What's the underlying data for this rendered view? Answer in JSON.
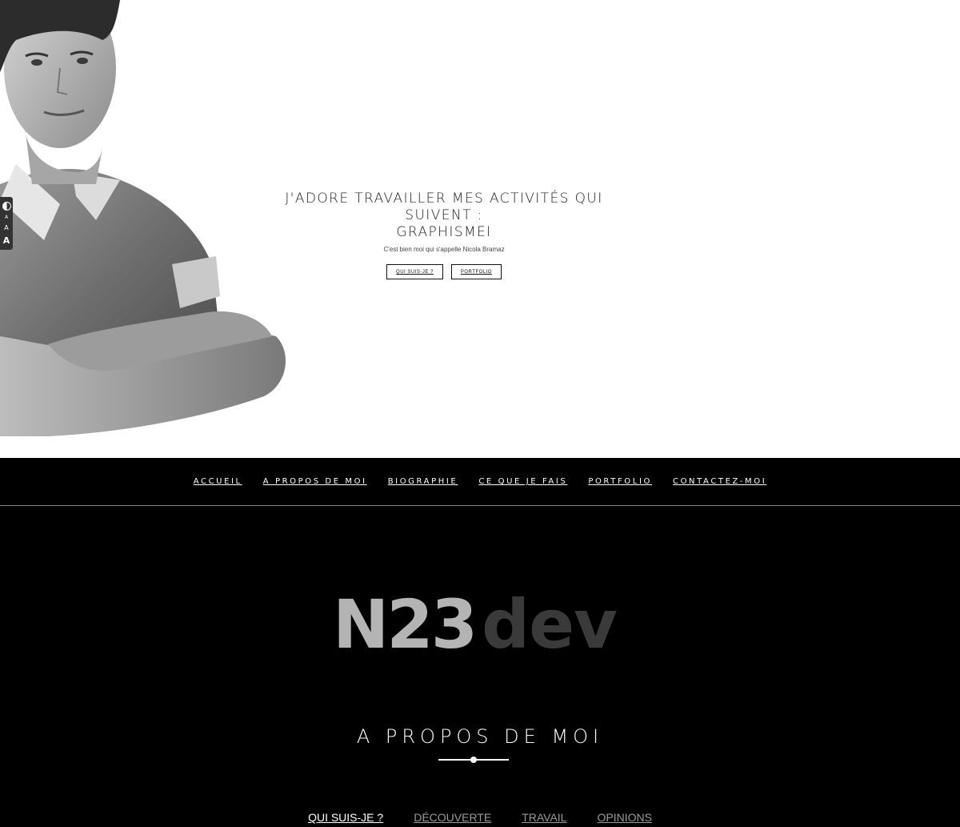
{
  "hero": {
    "title_line1": "J'ADORE TRAVAILLER MES ACTIVITÉS QUI SUIVENT :",
    "title_line2": "GRAPHISMEI",
    "subtitle": "C'est bien moi qui s'appelle Nicola Bramaz",
    "buttons": [
      "QUI SUIS-JE ?",
      "PORTFOLIO"
    ]
  },
  "accessibility": {
    "items": [
      "contrast-icon",
      "A",
      "A",
      "A"
    ]
  },
  "nav": {
    "items": [
      "ACCUEIL",
      "A PROPOS DE MOI",
      "BIOGRAPHIE",
      "CE QUE JE FAIS",
      "PORTFOLIO",
      "CONTACTEZ-MOI"
    ]
  },
  "logo": {
    "primary": "N23",
    "secondary": "dev"
  },
  "about": {
    "title": "A PROPOS DE MOI",
    "tabs": [
      "QUI SUIS-JE ?",
      "DÉCOUVERTE",
      "TRAVAIL",
      "OPINIONS"
    ],
    "active_tab": 0
  },
  "colors": {
    "hero_bg": "#ffffff",
    "page_bg": "#000000",
    "logo_primary": "#b4b4b4",
    "logo_secondary": "#3a3a3a",
    "tab_inactive": "#9a9a9a"
  }
}
